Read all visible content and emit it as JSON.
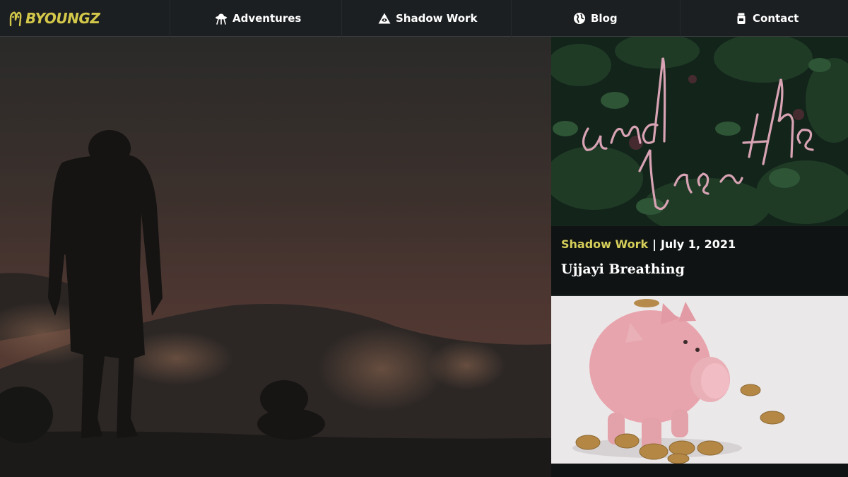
{
  "brand": {
    "name": "BYOUNGZ",
    "color": "#d4c84a"
  },
  "nav": {
    "items": [
      {
        "label": "Adventures",
        "icon": "ufo-icon"
      },
      {
        "label": "Shadow Work",
        "icon": "eye-pyramid-icon"
      },
      {
        "label": "Blog",
        "icon": "globe-icon"
      },
      {
        "label": "Contact",
        "icon": "jar-icon"
      }
    ]
  },
  "hero": {
    "image": "hiker-silhouette-at-dusk"
  },
  "posts": [
    {
      "category": "Shadow Work",
      "separator": "|",
      "date": "July 1, 2021",
      "title": "Ujjayi Breathing",
      "image": "neon-and-breathe-sign"
    },
    {
      "category": "",
      "date": "",
      "title": "",
      "image": "piggy-bank-with-coins"
    }
  ],
  "colors": {
    "accent": "#d5cf5a",
    "nav_bg": "#1c1f21",
    "card_bg": "#0f1313"
  }
}
